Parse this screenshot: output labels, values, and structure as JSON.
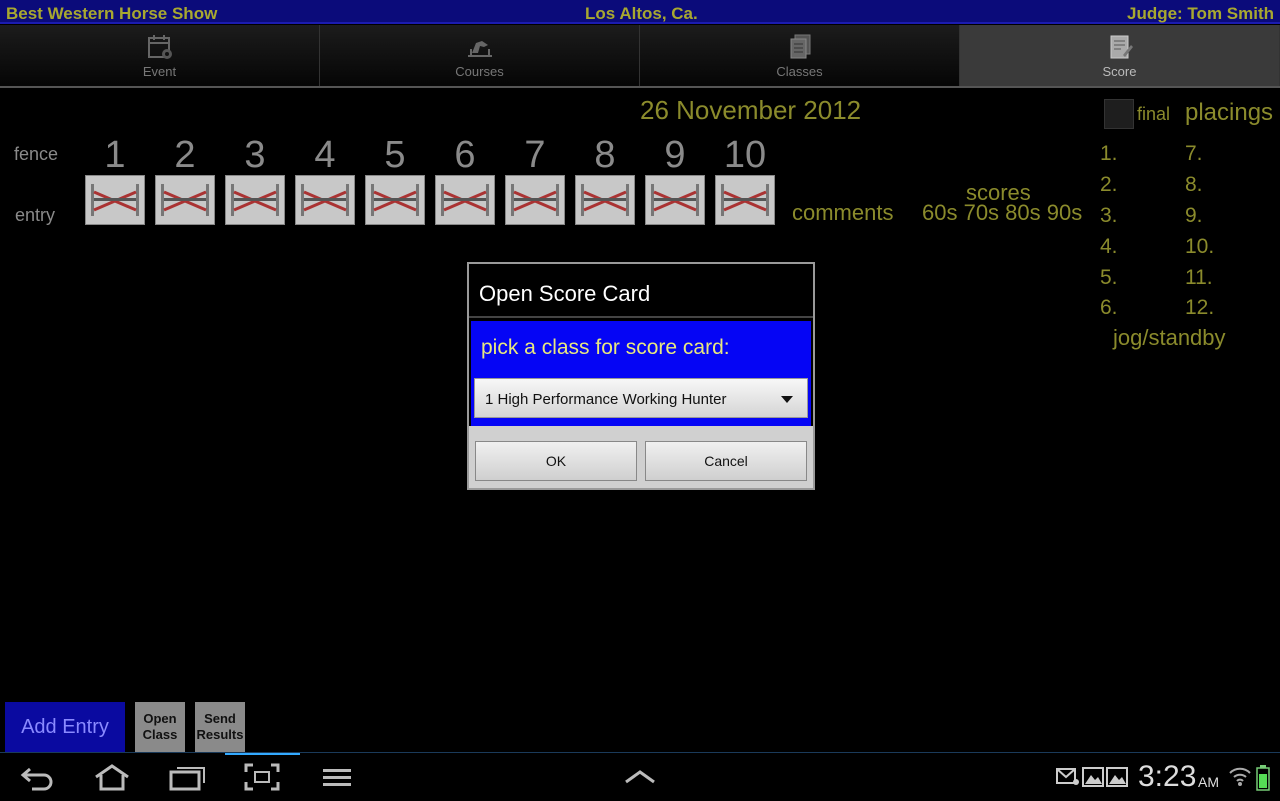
{
  "header": {
    "show_name": "Best Western Horse Show",
    "location": "Los Altos, Ca.",
    "judge": "Judge:  Tom Smith"
  },
  "tabs": [
    {
      "label": "Event",
      "icon": "calendar-gear-icon"
    },
    {
      "label": "Courses",
      "icon": "horse-jump-icon"
    },
    {
      "label": "Classes",
      "icon": "documents-icon"
    },
    {
      "label": "Score",
      "icon": "score-sheet-icon",
      "selected": true
    }
  ],
  "scorecard": {
    "date": "26 November 2012",
    "fence_label": "fence",
    "entry_label": "entry",
    "fences": [
      "1",
      "2",
      "3",
      "4",
      "5",
      "6",
      "7",
      "8",
      "9",
      "10"
    ],
    "comments_label": "comments",
    "scores_label": "scores",
    "scores_range": "60s 70s 80s 90s",
    "final_label": "final",
    "placings_label": "placings",
    "placings_left": [
      "1.",
      "2.",
      "3.",
      "4.",
      "5.",
      "6."
    ],
    "placings_right": [
      "7.",
      "8.",
      "9.",
      "10.",
      "11.",
      "12."
    ],
    "jog_label": "jog/standby"
  },
  "dialog": {
    "title": "Open Score Card",
    "prompt": "pick a class for score card:",
    "selected_class": "1 High Performance Working Hunter",
    "ok_label": "OK",
    "cancel_label": "Cancel"
  },
  "bottom_buttons": {
    "add_entry": "Add Entry",
    "open_class_1": "Open",
    "open_class_2": "Class",
    "send_results_1": "Send",
    "send_results_2": "Results"
  },
  "system_bar": {
    "time": "3:23",
    "ampm": "AM"
  },
  "colors": {
    "accent_text": "#8b8b2c",
    "header_bg": "#0b0b7a",
    "dialog_blue": "#0505f5",
    "add_entry_bg": "#0a0aa0"
  }
}
